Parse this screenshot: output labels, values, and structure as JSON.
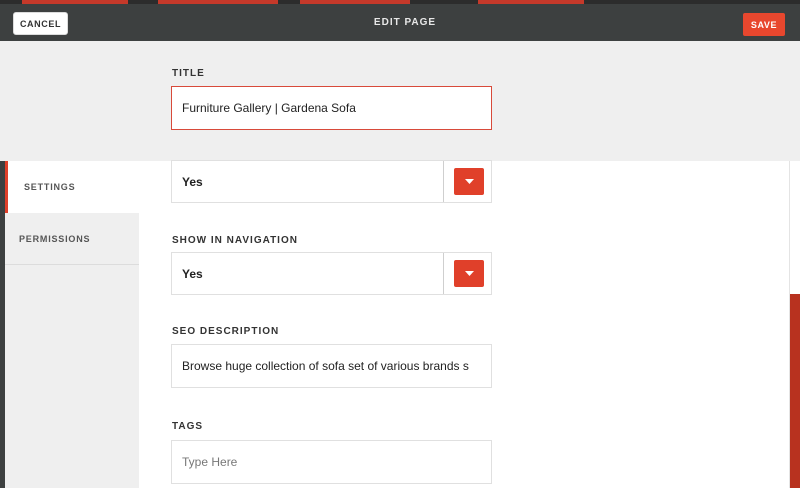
{
  "header": {
    "cancel_label": "CANCEL",
    "title": "EDIT PAGE",
    "save_label": "SAVE"
  },
  "sidebar": {
    "items": [
      {
        "label": "SETTINGS",
        "active": true
      },
      {
        "label": "PERMISSIONS",
        "active": false
      }
    ]
  },
  "form": {
    "title": {
      "label": "TITLE",
      "value": "Furniture Gallery | Gardena Sofa"
    },
    "published": {
      "value": "Yes"
    },
    "show_in_navigation": {
      "label": "SHOW IN NAVIGATION",
      "value": "Yes"
    },
    "seo_description": {
      "label": "SEO DESCRIPTION",
      "value": "Browse huge collection of sofa set of various brands s"
    },
    "tags": {
      "label": "TAGS",
      "placeholder": "Type Here"
    }
  },
  "colors": {
    "accent": "#e0402a",
    "header_bg": "#3d4040",
    "sidebar_bg": "#efefef"
  }
}
